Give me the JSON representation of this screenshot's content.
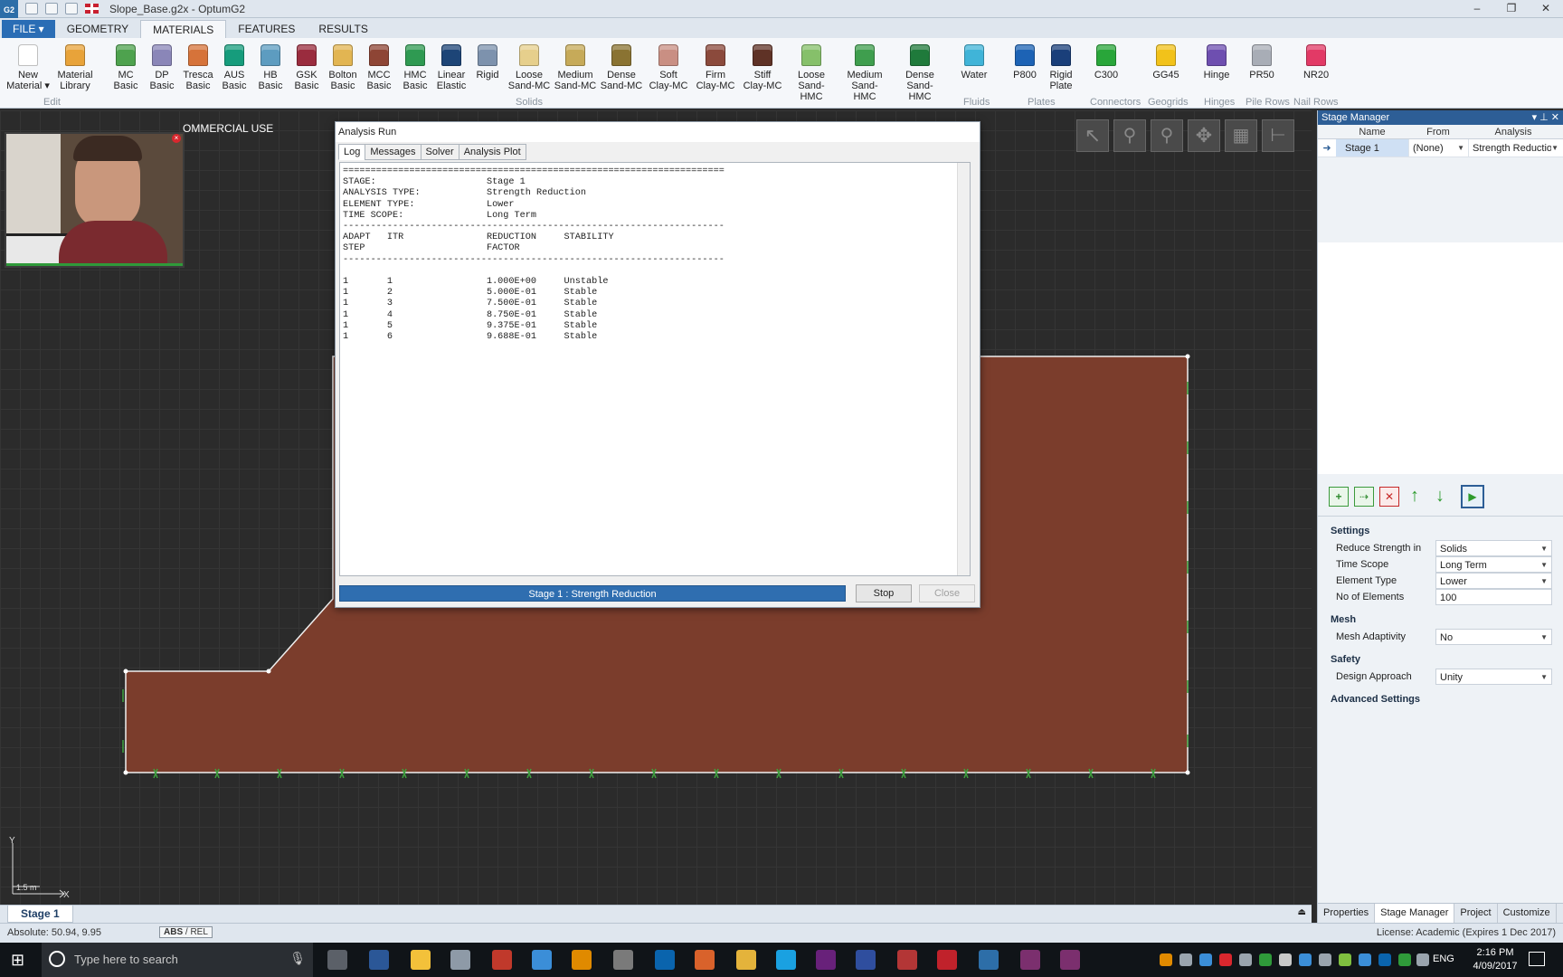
{
  "window": {
    "title": "Slope_Base.g2x - OptumG2",
    "app_badge": "G2",
    "minimize": "–",
    "restore": "❐",
    "close": "✕"
  },
  "ribbon_tabs": {
    "file": "FILE ▾",
    "tabs": [
      "GEOMETRY",
      "MATERIALS",
      "FEATURES",
      "RESULTS"
    ]
  },
  "ribbon": {
    "edit_buttons": [
      {
        "label": "New\nMaterial ▾",
        "color": "#ffffff",
        "icon": "new-material-icon"
      },
      {
        "label": "Material\nLibrary",
        "color": "#e8a33a",
        "icon": "library-icon"
      }
    ],
    "solids": [
      {
        "label": "MC\nBasic",
        "color": "#4ea24e"
      },
      {
        "label": "DP\nBasic",
        "color": "#8a86b8"
      },
      {
        "label": "Tresca\nBasic",
        "color": "#d6733a"
      },
      {
        "label": "AUS\nBasic",
        "color": "#169c7c"
      },
      {
        "label": "HB\nBasic",
        "color": "#5d9cc0"
      },
      {
        "label": "GSK\nBasic",
        "color": "#9a2c3e"
      },
      {
        "label": "Bolton\nBasic",
        "color": "#e2b552"
      },
      {
        "label": "MCC\nBasic",
        "color": "#8e4535"
      },
      {
        "label": "HMC\nBasic",
        "color": "#2f9a52"
      },
      {
        "label": "Linear\nElastic",
        "color": "#1d4577"
      },
      {
        "label": "Rigid",
        "color": "#7d92ad"
      },
      {
        "label": "Loose\nSand-MC",
        "color": "#e6cf8c"
      },
      {
        "label": "Medium\nSand-MC",
        "color": "#c6aa59"
      },
      {
        "label": "Dense\nSand-MC",
        "color": "#8a7332"
      },
      {
        "label": "Soft\nClay-MC",
        "color": "#c98f83"
      },
      {
        "label": "Firm\nClay-MC",
        "color": "#8b4a3c"
      },
      {
        "label": "Stiff\nClay-MC",
        "color": "#5f3226"
      },
      {
        "label": "Loose\nSand-HMC",
        "color": "#86c06a"
      },
      {
        "label": "Medium\nSand-HMC",
        "color": "#3f9e4e"
      },
      {
        "label": "Dense\nSand-HMC",
        "color": "#1f7a3b"
      }
    ],
    "fluids": [
      {
        "label": "Water",
        "color": "#40b4d8"
      }
    ],
    "plates": [
      {
        "label": "P800",
        "color": "#1d63b5"
      },
      {
        "label": "Rigid\nPlate",
        "color": "#1a3f7a"
      }
    ],
    "connectors": [
      {
        "label": "C300",
        "color": "#29a63a"
      }
    ],
    "geogrids": [
      {
        "label": "GG45",
        "color": "#f2c21a"
      }
    ],
    "hinges": [
      {
        "label": "Hinge",
        "color": "#6e4fb0"
      }
    ],
    "pile_rows": [
      {
        "label": "PR50",
        "color": "#a8adb6"
      }
    ],
    "nail_rows": [
      {
        "label": "NR20",
        "color": "#e23a66"
      }
    ],
    "groups": {
      "edit": "Edit",
      "solids": "Solids",
      "fluids": "Fluids",
      "plates": "Plates",
      "connectors": "Connectors",
      "geogrids": "Geogrids",
      "hinges": "Hinges",
      "pile_rows": "Pile Rows",
      "nail_rows": "Nail Rows"
    }
  },
  "canvas": {
    "watermark": "OMMERCIAL USE",
    "scale_label": "1.5 m",
    "axis_x": "X",
    "axis_y": "Y",
    "body_color": "#7b3d2c"
  },
  "dialog": {
    "title": "Analysis Run",
    "tabs": [
      "Log",
      "Messages",
      "Solver",
      "Analysis Plot"
    ],
    "log": "=====================================================================\nSTAGE:                    Stage 1\nANALYSIS TYPE:            Strength Reduction\nELEMENT TYPE:             Lower\nTIME SCOPE:               Long Term\n---------------------------------------------------------------------\nADAPT   ITR               REDUCTION     STABILITY\nSTEP                      FACTOR\n---------------------------------------------------------------------\n\n1       1                 1.000E+00     Unstable\n1       2                 5.000E-01     Stable\n1       3                 7.500E-01     Stable\n1       4                 8.750E-01     Stable\n1       5                 9.375E-01     Stable\n1       6                 9.688E-01     Stable",
    "progress_label": "Stage 1 : Strength Reduction",
    "stop": "Stop",
    "close": "Close"
  },
  "stage_manager": {
    "title": "Stage Manager",
    "columns": [
      "Name",
      "From",
      "Analysis"
    ],
    "row": {
      "name": "Stage 1",
      "from": "(None)",
      "analysis": "Strength Reductio"
    },
    "settings_title": "Settings",
    "settings": [
      {
        "key": "Reduce Strength in",
        "value": "Solids"
      },
      {
        "key": "Time Scope",
        "value": "Long Term"
      },
      {
        "key": "Element Type",
        "value": "Lower"
      },
      {
        "key": "No of Elements",
        "value": "100"
      }
    ],
    "mesh_title": "Mesh",
    "mesh": [
      {
        "key": "Mesh Adaptivity",
        "value": "No"
      }
    ],
    "safety_title": "Safety",
    "safety": [
      {
        "key": "Design Approach",
        "value": "Unity"
      }
    ],
    "advanced_title": "Advanced Settings",
    "bottom_tabs": [
      "Properties",
      "Stage Manager",
      "Project",
      "Customize"
    ]
  },
  "stage_tab": "Stage 1",
  "status": {
    "absolute": "Absolute:    50.94, 9.95",
    "abs": "ABS",
    "rel": "/ REL",
    "license": "License: Academic (Expires 1 Dec 2017)"
  },
  "taskbar": {
    "search_placeholder": "Type here to search",
    "lang": "ENG",
    "time": "2:16 PM",
    "date": "4/09/2017"
  }
}
